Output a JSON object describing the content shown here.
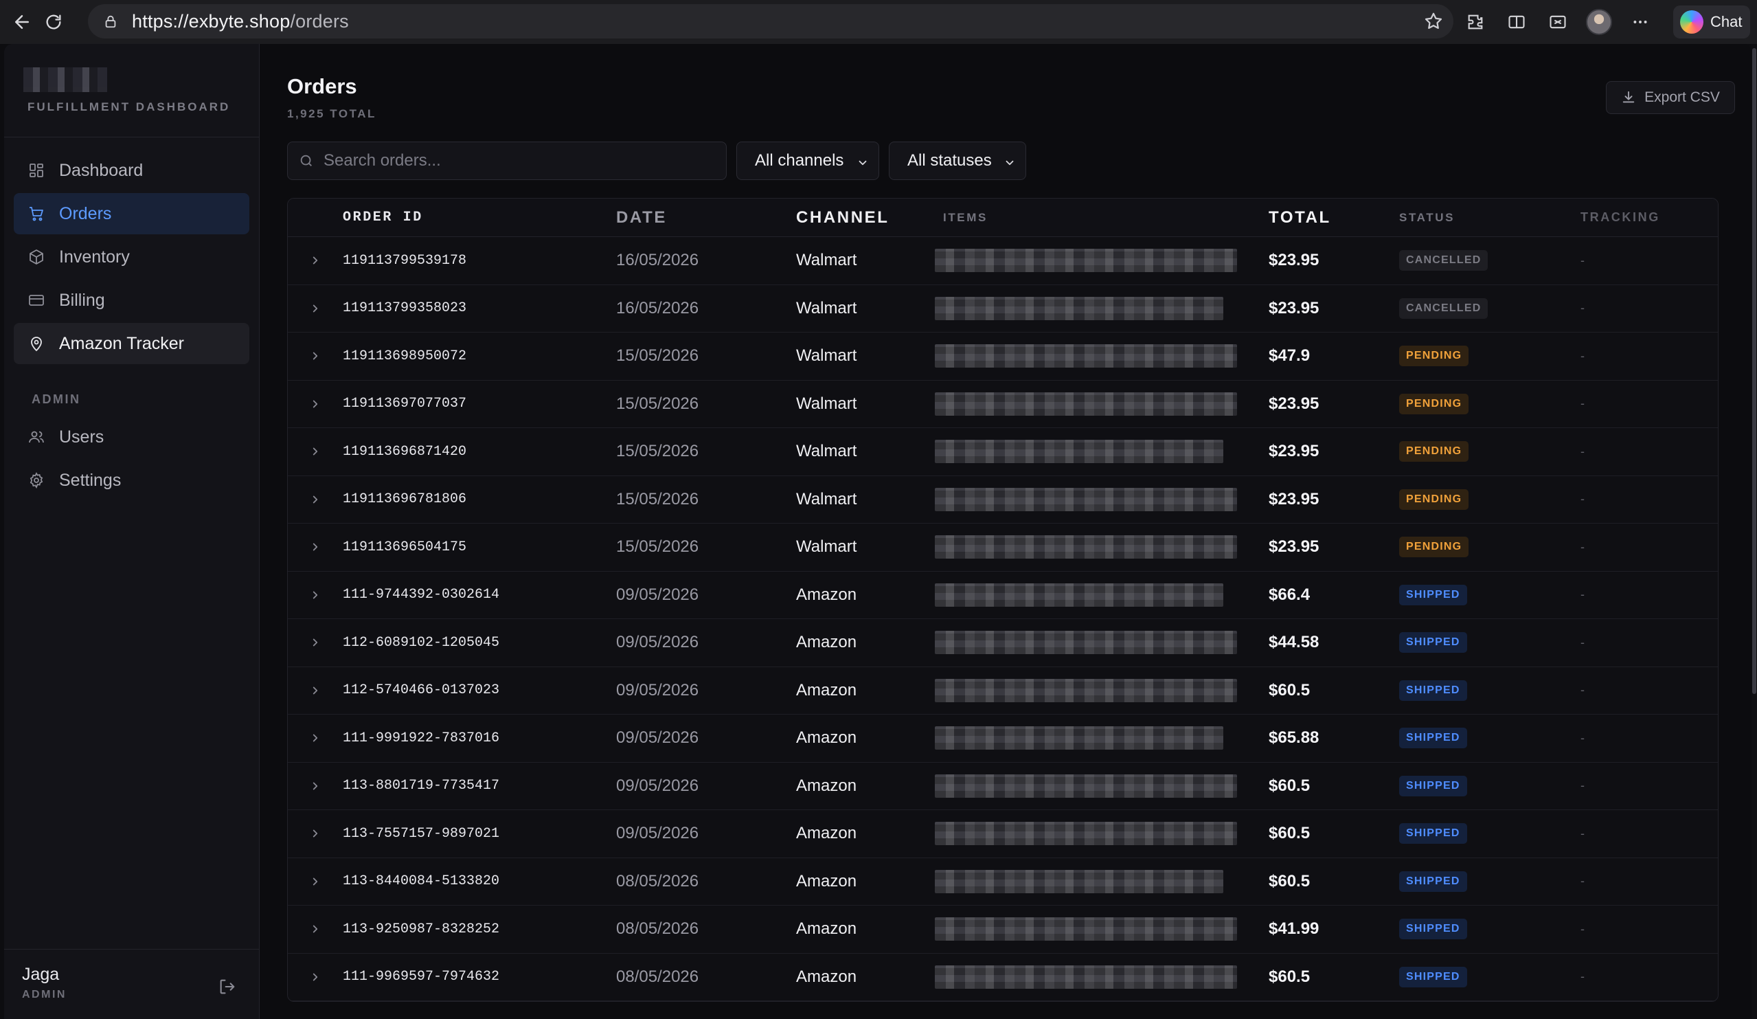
{
  "browser": {
    "url_host": "https://exbyte.shop",
    "url_path": "/orders",
    "chat_label": "Chat"
  },
  "sidebar": {
    "brand_subtitle": "FULFILLMENT DASHBOARD",
    "items": [
      {
        "label": "Dashboard",
        "icon": "dashboard-icon"
      },
      {
        "label": "Orders",
        "icon": "cart-icon"
      },
      {
        "label": "Inventory",
        "icon": "box-icon"
      },
      {
        "label": "Billing",
        "icon": "card-icon"
      },
      {
        "label": "Amazon Tracker",
        "icon": "map-pin-icon"
      }
    ],
    "admin_section": "ADMIN",
    "admin_items": [
      {
        "label": "Users",
        "icon": "users-icon"
      },
      {
        "label": "Settings",
        "icon": "gear-icon"
      }
    ],
    "user": {
      "name": "Jaga",
      "role": "ADMIN"
    }
  },
  "main": {
    "title": "Orders",
    "count": "1,925 TOTAL",
    "export_label": "Export CSV",
    "search_placeholder": "Search orders...",
    "channel_filter": "All channels",
    "status_filter": "All statuses",
    "columns": [
      "ORDER ID",
      "DATE",
      "CHANNEL",
      "ITEMS",
      "TOTAL",
      "STATUS",
      "TRACKING"
    ],
    "orders": [
      {
        "id": "119113799539178",
        "date": "16/05/2026",
        "channel": "Walmart",
        "total": "$23.95",
        "status": "CANCELLED",
        "tracking": "-"
      },
      {
        "id": "119113799358023",
        "date": "16/05/2026",
        "channel": "Walmart",
        "total": "$23.95",
        "status": "CANCELLED",
        "tracking": "-"
      },
      {
        "id": "119113698950072",
        "date": "15/05/2026",
        "channel": "Walmart",
        "total": "$47.9",
        "status": "PENDING",
        "tracking": "-"
      },
      {
        "id": "119113697077037",
        "date": "15/05/2026",
        "channel": "Walmart",
        "total": "$23.95",
        "status": "PENDING",
        "tracking": "-"
      },
      {
        "id": "119113696871420",
        "date": "15/05/2026",
        "channel": "Walmart",
        "total": "$23.95",
        "status": "PENDING",
        "tracking": "-"
      },
      {
        "id": "119113696781806",
        "date": "15/05/2026",
        "channel": "Walmart",
        "total": "$23.95",
        "status": "PENDING",
        "tracking": "-"
      },
      {
        "id": "119113696504175",
        "date": "15/05/2026",
        "channel": "Walmart",
        "total": "$23.95",
        "status": "PENDING",
        "tracking": "-"
      },
      {
        "id": "111-9744392-0302614",
        "date": "09/05/2026",
        "channel": "Amazon",
        "total": "$66.4",
        "status": "SHIPPED",
        "tracking": "-"
      },
      {
        "id": "112-6089102-1205045",
        "date": "09/05/2026",
        "channel": "Amazon",
        "total": "$44.58",
        "status": "SHIPPED",
        "tracking": "-"
      },
      {
        "id": "112-5740466-0137023",
        "date": "09/05/2026",
        "channel": "Amazon",
        "total": "$60.5",
        "status": "SHIPPED",
        "tracking": "-"
      },
      {
        "id": "111-9991922-7837016",
        "date": "09/05/2026",
        "channel": "Amazon",
        "total": "$65.88",
        "status": "SHIPPED",
        "tracking": "-"
      },
      {
        "id": "113-8801719-7735417",
        "date": "09/05/2026",
        "channel": "Amazon",
        "total": "$60.5",
        "status": "SHIPPED",
        "tracking": "-"
      },
      {
        "id": "113-7557157-9897021",
        "date": "09/05/2026",
        "channel": "Amazon",
        "total": "$60.5",
        "status": "SHIPPED",
        "tracking": "-"
      },
      {
        "id": "113-8440084-5133820",
        "date": "08/05/2026",
        "channel": "Amazon",
        "total": "$60.5",
        "status": "SHIPPED",
        "tracking": "-"
      },
      {
        "id": "113-9250987-8328252",
        "date": "08/05/2026",
        "channel": "Amazon",
        "total": "$41.99",
        "status": "SHIPPED",
        "tracking": "-"
      },
      {
        "id": "111-9969597-7974632",
        "date": "08/05/2026",
        "channel": "Amazon",
        "total": "$60.5",
        "status": "SHIPPED",
        "tracking": "-"
      }
    ]
  },
  "colors": {
    "accent": "#5d9bff",
    "pending": "#f0a13a",
    "shipped": "#4f8dff",
    "cancelled": "#7b7b84"
  }
}
